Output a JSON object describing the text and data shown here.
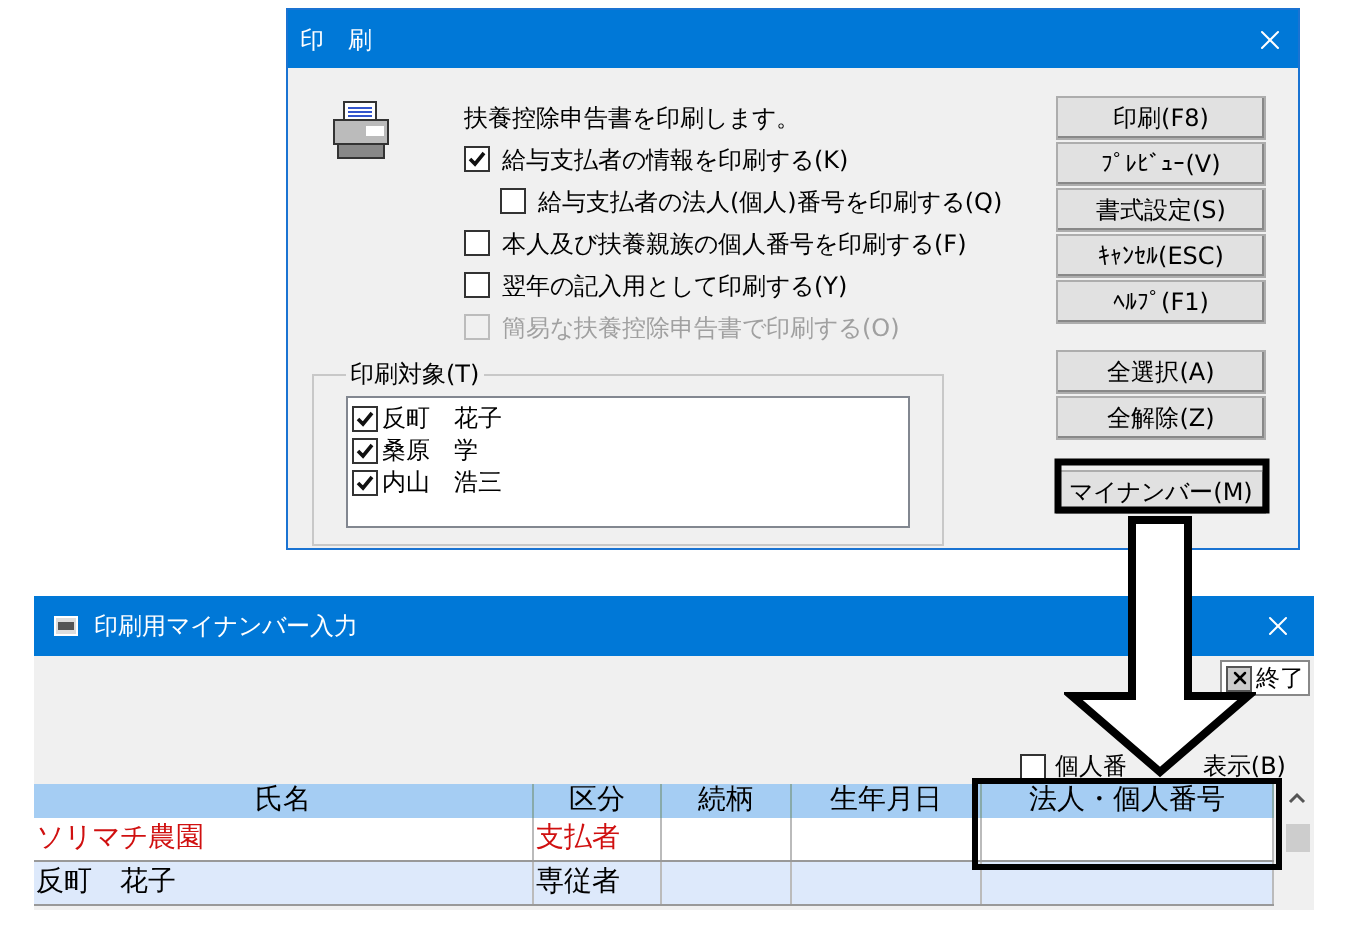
{
  "print_dialog": {
    "title": "印　刷",
    "message": "扶養控除申告書を印刷します。",
    "options": [
      {
        "label": "給与支払者の情報を印刷する(K)",
        "checked": true,
        "disabled": false,
        "children": [
          {
            "label": "給与支払者の法人(個人)番号を印刷する(Q)",
            "checked": false,
            "disabled": false
          }
        ]
      },
      {
        "label": "本人及び扶養親族の個人番号を印刷する(F)",
        "checked": false,
        "disabled": false
      },
      {
        "label": "翌年の記入用として印刷する(Y)",
        "checked": false,
        "disabled": false
      },
      {
        "label": "簡易な扶養控除申告書で印刷する(O)",
        "checked": false,
        "disabled": true
      }
    ],
    "buttons": [
      "印刷(F8)",
      "ﾌﾟﾚﾋﾞｭｰ(V)",
      "書式設定(S)",
      "ｷｬﾝｾﾙ(ESC)",
      "ﾍﾙﾌﾟ(F1)",
      "全選択(A)",
      "全解除(Z)",
      "マイナンバー(M)"
    ],
    "targets": {
      "label": "印刷対象(T)",
      "items": [
        {
          "name": "反町　花子",
          "checked": true
        },
        {
          "name": "桑原　学",
          "checked": true
        },
        {
          "name": "内山　浩三",
          "checked": true
        }
      ]
    }
  },
  "mynumber_window": {
    "title": "印刷用マイナンバー入力",
    "exit_button": "終了",
    "show_number": {
      "label_parts": [
        "個人番",
        "表示(B)"
      ],
      "checked": false
    },
    "table": {
      "columns": [
        "氏名",
        "区分",
        "続柄",
        "生年月日",
        "法人・個人番号"
      ],
      "rows": [
        {
          "kind": "payer",
          "cells": [
            "ソリマチ農園",
            "支払者",
            "",
            "",
            ""
          ]
        },
        {
          "kind": "person",
          "cells": [
            "反町　花子",
            "専従者",
            "",
            "",
            ""
          ]
        }
      ]
    }
  }
}
